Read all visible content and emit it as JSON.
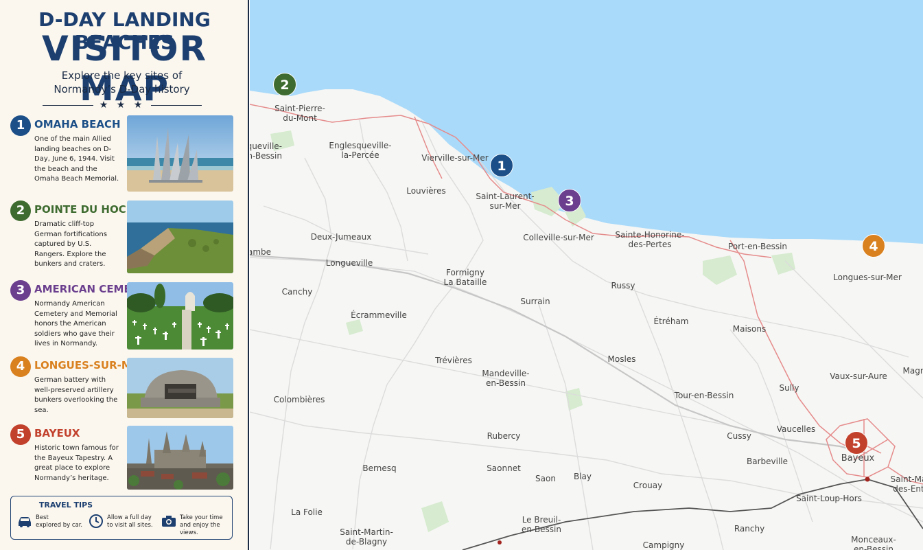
{
  "header": {
    "title_line1": "D-DAY LANDING BEACHES",
    "title_line2": "VISITOR MAP",
    "subtitle_line1": "Explore the key sites of",
    "subtitle_line2": "Normandy’s D-Day history",
    "stars": "★ ★ ★"
  },
  "colors": {
    "blue": "#1c4f87",
    "green": "#3e6b2f",
    "purple": "#6b3f8e",
    "orange": "#d9801f",
    "red": "#c2412d",
    "sea": "#a9dafa",
    "navy": "#1c3f70"
  },
  "sites": [
    {
      "number": "1",
      "name": "OMAHA BEACH",
      "color": "#1c4f87",
      "description": "One of the main Allied landing beaches on D-Day, June 6, 1944. Visit the beach and the Omaha Beach Memorial.",
      "photo": "omaha-beach-memorial-photo"
    },
    {
      "number": "2",
      "name": "POINTE DU HOC",
      "color": "#3e6b2f",
      "description": "Dramatic cliff-top German fortifications captured by U.S. Rangers. Explore the bunkers and craters.",
      "photo": "pointe-du-hoc-cliffs-photo"
    },
    {
      "number": "3",
      "name": "AMERICAN CEMETERY",
      "color": "#6b3f8e",
      "description": "Normandy American Cemetery and Memorial honors the American soldiers who gave their lives in Normandy.",
      "photo": "american-cemetery-crosses-photo"
    },
    {
      "number": "4",
      "name": "LONGUES-SUR-MER",
      "color": "#d9801f",
      "description": "German battery with well-preserved artillery bunkers overlooking the sea.",
      "photo": "longues-battery-bunker-photo"
    },
    {
      "number": "5",
      "name": "BAYEUX",
      "color": "#c2412d",
      "description": "Historic town famous for the Bayeux Tapestry. A great place to explore Normandy’s heritage.",
      "photo": "bayeux-cathedral-photo"
    }
  ],
  "tips": {
    "title": "TRAVEL TIPS",
    "items": [
      {
        "icon": "car-icon",
        "line1": "Best",
        "line2": "explored by car."
      },
      {
        "icon": "clock-icon",
        "line1": "Allow a full day",
        "line2": "to visit all sites."
      },
      {
        "icon": "camera-icon",
        "line1": "Take your time",
        "line2": "and enjoy the",
        "line3": "views."
      }
    ]
  },
  "map": {
    "towns": {
      "saint_pierre": [
        "Saint-Pierre-",
        "du-Mont"
      ],
      "cricqueville": [
        "cqueville-",
        "en-Bessin"
      ],
      "englesqueville": [
        "Englesqueville-",
        "la-Percée"
      ],
      "vierville": [
        "Vierville-sur-Mer"
      ],
      "louvieres": [
        "Louvières"
      ],
      "saint_laurent": [
        "Saint-Laurent-",
        "sur-Mer"
      ],
      "colleville": [
        "Colleville-sur-Mer"
      ],
      "sainte_honorine": [
        "Sainte-Honorine-",
        "des-Pertes"
      ],
      "port_en_bessin": [
        "Port-en-Bessin"
      ],
      "longues": [
        "Longues-sur-Mer"
      ],
      "deux_jumeaux": [
        "Deux-Jumeaux"
      ],
      "cambe": [
        "ambe"
      ],
      "longueville": [
        "Longueville"
      ],
      "formigny": [
        "Formigny",
        "La Bataille"
      ],
      "russy": [
        "Russy"
      ],
      "canchy": [
        "Canchy"
      ],
      "surrain": [
        "Surrain"
      ],
      "ecrammeville": [
        "Écrammeville"
      ],
      "etreham": [
        "Étréham"
      ],
      "maisons": [
        "Maisons"
      ],
      "trevieres": [
        "Trévières"
      ],
      "mosles": [
        "Mosles"
      ],
      "mandeville": [
        "Mandeville-",
        "en-Bessin"
      ],
      "vaux_sur_aure": [
        "Vaux-sur-Aure"
      ],
      "magny": [
        "Magn"
      ],
      "sully": [
        "Sully"
      ],
      "colombieres": [
        "Colombières"
      ],
      "tour_en_bessin": [
        "Tour-en-Bessin"
      ],
      "rubercy": [
        "Rubercy"
      ],
      "cussy": [
        "Cussy"
      ],
      "vaucelles": [
        "Vaucelles"
      ],
      "bayeux": [
        "Bayeux"
      ],
      "bernesq": [
        "Bernesq"
      ],
      "saonnet": [
        "Saonnet"
      ],
      "barbeville": [
        "Barbeville"
      ],
      "saon": [
        "Saon"
      ],
      "blay": [
        "Blay"
      ],
      "crouay": [
        "Crouay"
      ],
      "saint_martin_des_entrees": [
        "Saint-Ma",
        "des-Ent"
      ],
      "saint_loup_hors": [
        "Saint-Loup-Hors"
      ],
      "la_folie": [
        "La Folie"
      ],
      "le_breuil": [
        "Le Breuil-",
        "en-Bessin"
      ],
      "ranchy": [
        "Ranchy"
      ],
      "saint_martin_de_blagny": [
        "Saint-Martin-",
        "de-Blagny"
      ],
      "campigny": [
        "Campigny"
      ],
      "monceaux": [
        "Monceaux-",
        "en-Bessin"
      ]
    }
  }
}
